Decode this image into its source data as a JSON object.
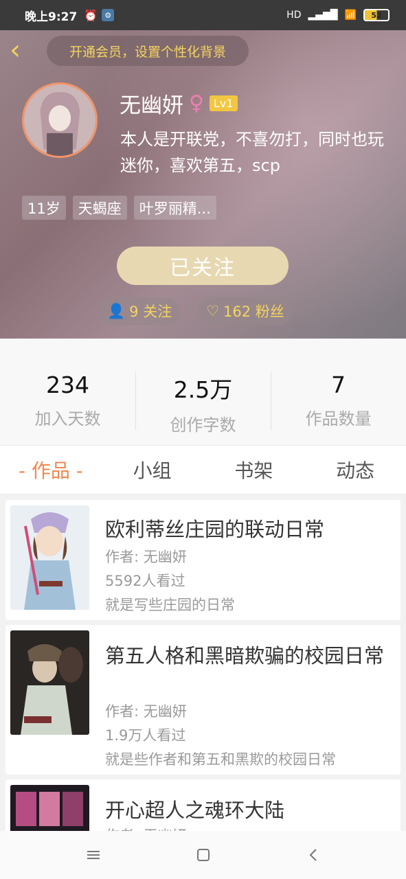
{
  "status": {
    "time": "晚上9:27",
    "network": "HD",
    "battery": "52"
  },
  "header": {
    "vip_banner": "开通会员，设置个性化背景",
    "username": "无幽妍",
    "gender_symbol": "♀",
    "level": "Lv1",
    "bio": "本人是开联党，不喜勿打，同时也玩迷你，喜欢第五，scp",
    "tags": [
      "11岁",
      "天蝎座",
      "叶罗丽精..."
    ],
    "follow_button": "已关注",
    "following_count": "9 关注",
    "followers_count": "162 粉丝"
  },
  "stats": [
    {
      "value": "234",
      "label": "加入天数"
    },
    {
      "value": "2.5万",
      "label": "创作字数"
    },
    {
      "value": "7",
      "label": "作品数量"
    }
  ],
  "tabs": [
    "- 作品 -",
    "小组",
    "书架",
    "动态"
  ],
  "works": [
    {
      "title": "欧利蒂丝庄园的联动日常",
      "author": "作者: 无幽妍",
      "views": "5592人看过",
      "desc": "就是写些庄园的日常"
    },
    {
      "title": "第五人格和黑暗欺骗的校园日常",
      "author": "作者: 无幽妍",
      "views": "1.9万人看过",
      "desc": "就是些作者和第五和黑欺的校园日常"
    },
    {
      "title": "开心超人之魂环大陆",
      "author": "作者: 无幽妍"
    }
  ],
  "colors": {
    "accent": "#f0874f",
    "gold": "#f5d45e",
    "follow_btn": "#e7d8b1"
  }
}
